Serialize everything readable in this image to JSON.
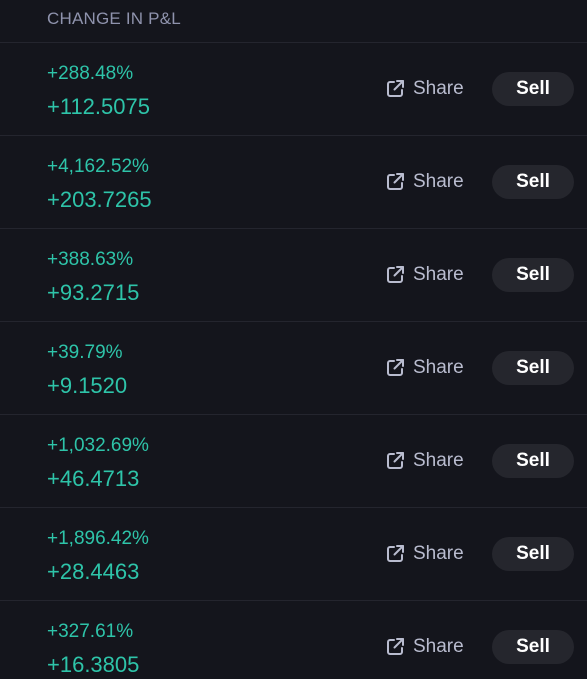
{
  "header": {
    "label": "CHANGE IN P&L"
  },
  "rows": [
    {
      "pct": "+288.48%",
      "abs": "+112.5075",
      "share_label": "Share",
      "sell_label": "Sell"
    },
    {
      "pct": "+4,162.52%",
      "abs": "+203.7265",
      "share_label": "Share",
      "sell_label": "Sell"
    },
    {
      "pct": "+388.63%",
      "abs": "+93.2715",
      "share_label": "Share",
      "sell_label": "Sell"
    },
    {
      "pct": "+39.79%",
      "abs": "+9.1520",
      "share_label": "Share",
      "sell_label": "Sell"
    },
    {
      "pct": "+1,032.69%",
      "abs": "+46.4713",
      "share_label": "Share",
      "sell_label": "Sell"
    },
    {
      "pct": "+1,896.42%",
      "abs": "+28.4463",
      "share_label": "Share",
      "sell_label": "Sell"
    },
    {
      "pct": "+327.61%",
      "abs": "+16.3805",
      "share_label": "Share",
      "sell_label": "Sell"
    }
  ],
  "icons": {
    "share": "share-external-icon"
  },
  "colors": {
    "background": "#14151c",
    "gain": "#2ec4a9",
    "header_text": "#8f93ad",
    "share_text": "#b9bccf",
    "sell_bg": "#25262d",
    "sell_text": "#ffffff"
  }
}
